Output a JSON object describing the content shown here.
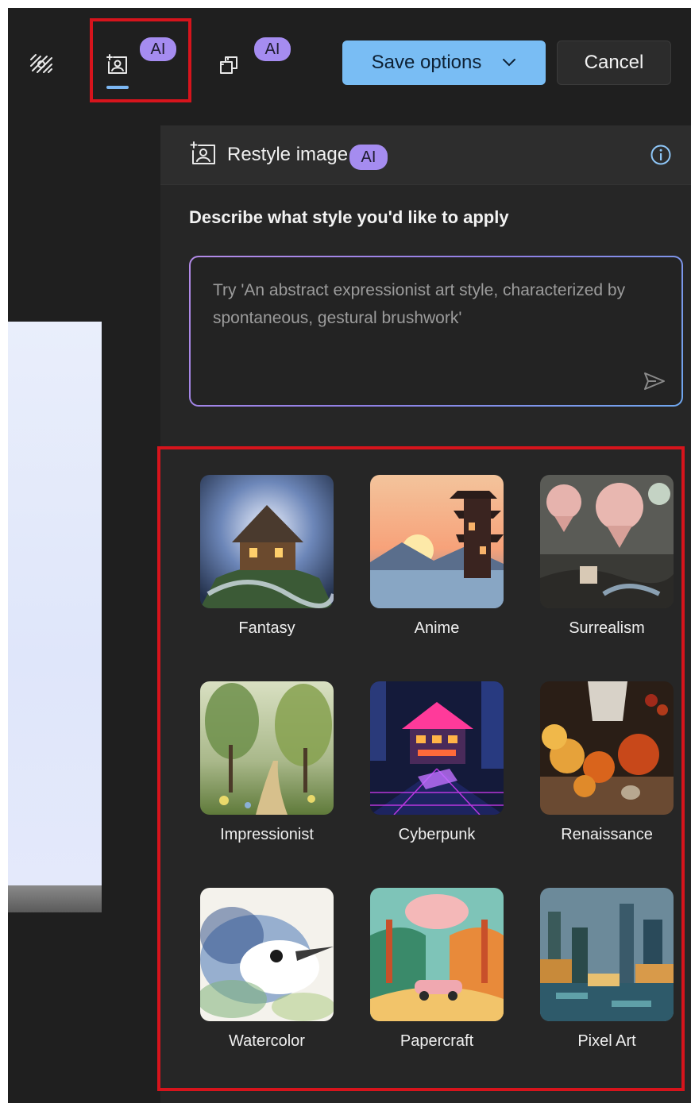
{
  "toolbar": {
    "ai_badge_1": "AI",
    "ai_badge_2": "AI",
    "save_label": "Save options",
    "cancel_label": "Cancel"
  },
  "panel": {
    "title": "Restyle image",
    "ai_badge": "AI",
    "prompt_label": "Describe what style you'd like to apply",
    "prompt_placeholder": "Try 'An abstract expressionist art style, characterized by spontaneous, gestural brushwork'"
  },
  "styles": [
    {
      "label": "Fantasy"
    },
    {
      "label": "Anime"
    },
    {
      "label": "Surrealism"
    },
    {
      "label": "Impressionist"
    },
    {
      "label": "Cyberpunk"
    },
    {
      "label": "Renaissance"
    },
    {
      "label": "Watercolor"
    },
    {
      "label": "Papercraft"
    },
    {
      "label": "Pixel Art"
    }
  ],
  "colors": {
    "accent_button": "#79bdf4",
    "ai_badge": "#a58cf0",
    "highlight_box": "#d6141c",
    "active_underline": "#7cb7f3"
  },
  "icons": {
    "tool_1": "background-blur-icon",
    "tool_2": "restyle-image-icon",
    "tool_3": "generative-erase-icon",
    "info": "info-icon",
    "send": "send-icon",
    "dropdown": "chevron-down-icon"
  }
}
